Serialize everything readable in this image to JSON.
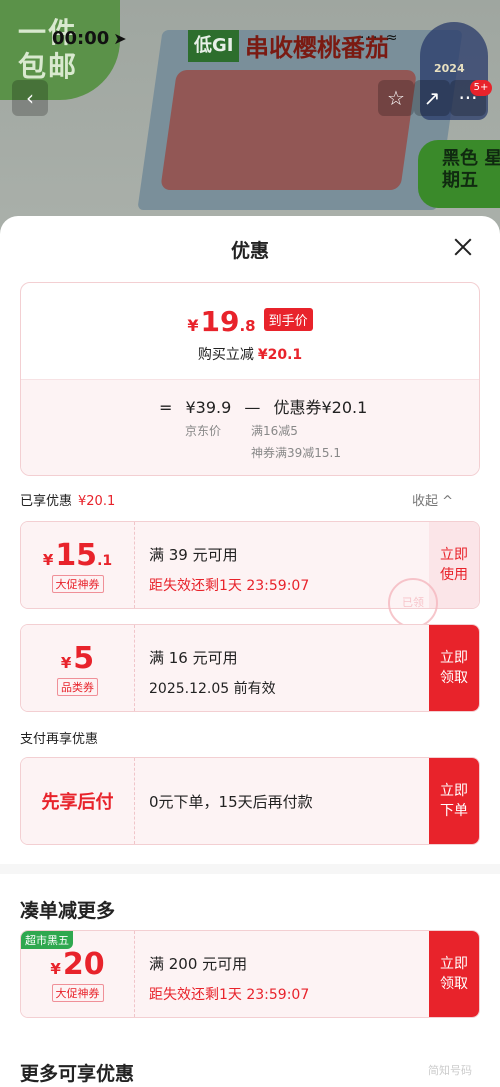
{
  "status_bar": {
    "time": "00:00",
    "signal": "··· ≈"
  },
  "background": {
    "promo_text": "一件 包邮",
    "title_badge": "低GI",
    "title": "串收樱桃番茄",
    "award_year": "2024",
    "black_friday": "黑色 星期五"
  },
  "nav": {
    "back": "‹",
    "favorite": "☆",
    "share": "↗",
    "more": "···",
    "badge": "5+"
  },
  "sheet": {
    "title": "优惠",
    "summary": {
      "yen": "¥",
      "price_int": "19",
      "price_dec": ".8",
      "price_tag": "到手价",
      "discount_label": "购买立减",
      "discount_value": "¥20.1",
      "equation_eq": "=",
      "jd_price": "¥39.9",
      "minus": "—",
      "coupon_total": "优惠券¥20.1",
      "jd_label": "京东价",
      "coupon_detail_1": "满16减5",
      "coupon_detail_2": "神券满39减15.1"
    },
    "enjoyed_label": "已享优惠",
    "enjoyed_value": "¥20.1",
    "collapse_label": "收起 ^",
    "coupons": [
      {
        "yen": "¥",
        "amount": "15",
        "decimal": ".1",
        "type": "大促神券",
        "condition": "满 39 元可用",
        "expiry": "距失效还剩1天 23:59:07",
        "action": "立即 使用"
      },
      {
        "yen": "¥",
        "amount": "5",
        "decimal": "",
        "type": "品类券",
        "condition": "满 16 元可用",
        "expiry": "2025.12.05 前有效",
        "action": "立即 领取"
      }
    ],
    "stamp": "已领",
    "pay_label": "支付再享优惠",
    "pay_offer": {
      "left": "先享后付",
      "description": "0元下单，15天后再付款",
      "action": "立即 下单"
    },
    "more_deals_title": "凑单减更多",
    "more_coupon": {
      "tag": "超市黑五",
      "yen": "¥",
      "amount": "20",
      "type": "大促神券",
      "condition": "满 200 元可用",
      "expiry": "距失效还剩1天 23:59:07",
      "action": "立即 领取"
    },
    "more_enjoy_title": "更多可享优惠"
  },
  "watermark": "简知号码"
}
